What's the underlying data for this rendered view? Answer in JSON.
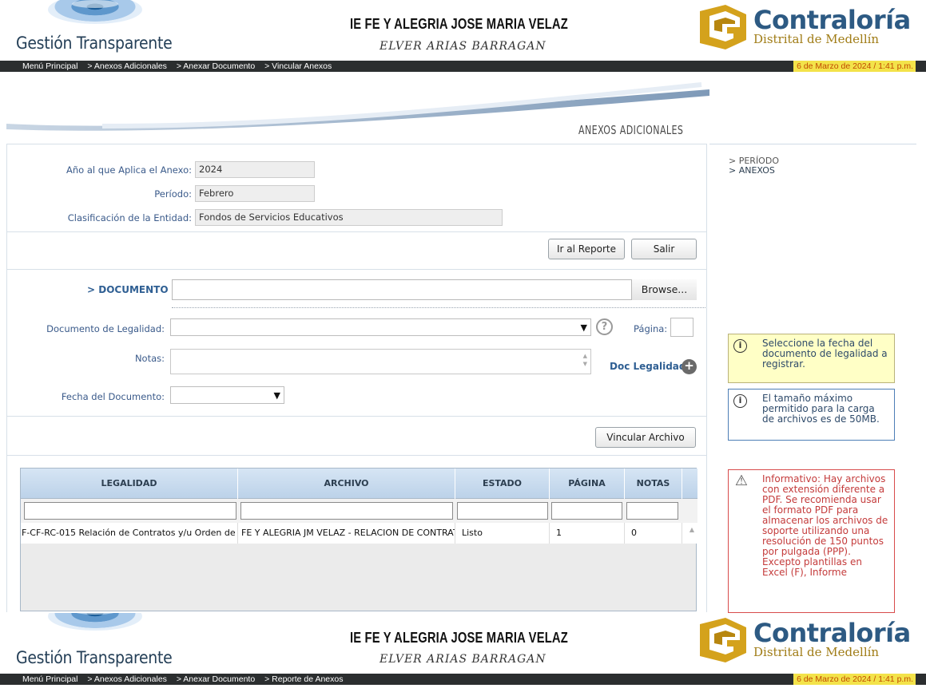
{
  "header": {
    "brand": "Gestión Transparente",
    "entity": "IE FE Y ALEGRIA JOSE MARIA VELAZ",
    "user": "ELVER ARIAS BARRAGAN",
    "org_name": "Contraloría",
    "org_sub": "Distrital de Medellín"
  },
  "breadcrumb_top": [
    "Menú Principal",
    "> Anexos Adicionales",
    "> Anexar Documento",
    "> Vincular Anexos"
  ],
  "breadcrumb_bottom": [
    "Menú Principal",
    "> Anexos Adicionales",
    "> Anexar Documento",
    "> Reporte de Anexos"
  ],
  "datetime": "6 de Marzo de 2024 / 1:41 p.m.",
  "panel_title": "ANEXOS ADICIONALES",
  "info": {
    "year_label": "Año al que Aplica el Anexo:",
    "year_value": "2024",
    "period_label": "Período:",
    "period_value": "Febrero",
    "class_label": "Clasificación de la Entidad:",
    "class_value": "Fondos de Servicios Educativos"
  },
  "buttons": {
    "report": "Ir al Reporte",
    "exit": "Salir",
    "browse": "Browse...",
    "link_file": "Vincular Archivo"
  },
  "form": {
    "document_label": "> DOCUMENTO",
    "legal_doc_label": "Documento de Legalidad:",
    "page_label": "Página:",
    "notes_label": "Notas:",
    "doc_legalidad_link": "Doc Legalidad",
    "date_label": "Fecha del Documento:"
  },
  "table": {
    "columns": [
      "LEGALIDAD",
      "ARCHIVO",
      "ESTADO",
      "PÁGINA",
      "NOTAS"
    ],
    "rows": [
      [
        "F-CF-RC-015 Relación de Contratos y/u Orden de",
        "FE Y ALEGRIA JM VELAZ - RELACION DE CONTRATOS",
        "Listo",
        "1",
        "0"
      ]
    ]
  },
  "sidebar": {
    "steps": [
      "> PERÍODO",
      "> ANEXOS"
    ],
    "note_date": "Seleccione la fecha del documento de legalidad a registrar.",
    "note_size": "El tamaño máximo permitido para la carga de archivos es de 50MB.",
    "note_warning": "Informativo: Hay archivos con extensión diferente a PDF. Se recomienda usar el formato PDF para almacenar los archivos de soporte utilizando una resolución de 150 puntos por pulgada (PPP). Excepto plantillas en Excel (F), Informe"
  },
  "colors": {
    "crumb_bar": "#2b2e2f",
    "date_highlight": "#f3e34a",
    "label_blue": "#3a5a8a",
    "grid_header": "#c7dbef",
    "warning_red": "#c43b3b"
  }
}
